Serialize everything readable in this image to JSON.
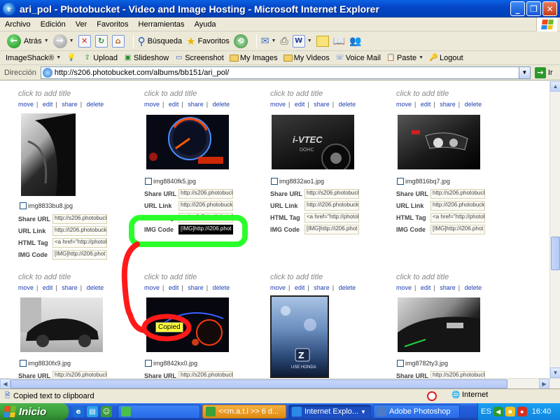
{
  "window": {
    "title": "ari_pol - Photobucket - Video and Image Hosting - Microsoft Internet Explorer",
    "controls": [
      "minimize",
      "maximize",
      "close"
    ]
  },
  "menu": [
    "Archivo",
    "Edición",
    "Ver",
    "Favoritos",
    "Herramientas",
    "Ayuda"
  ],
  "toolbar": {
    "back": "Atrás",
    "search": "Búsqueda",
    "favorites": "Favoritos"
  },
  "links_bar": {
    "imageshack": "ImageShack®",
    "upload": "Upload",
    "slideshow": "Slideshow",
    "screenshot": "Screenshot",
    "my_images": "My Images",
    "my_videos": "My Videos",
    "voice_mail": "Voice Mail",
    "paste": "Paste",
    "logout": "Logout"
  },
  "address": {
    "label": "Dirección",
    "url": "http://s206.photobucket.com/albums/bb151/ari_pol/",
    "go": "Ir"
  },
  "tile_common": {
    "title": "click to add title",
    "actions": [
      "move",
      "edit",
      "share",
      "delete"
    ],
    "labels": [
      "Share URL",
      "URL Link",
      "HTML Tag",
      "IMG Code"
    ],
    "values": [
      "http://s206.photobuck",
      "http://i206.photobuck",
      "<a href=\"http://photol",
      "[IMG]http://i206.phot"
    ]
  },
  "tiles_row1": [
    {
      "filename": "img8833bu8.jpg"
    },
    {
      "filename": "img8840fk5.jpg"
    },
    {
      "filename": "img8832ao1.jpg"
    },
    {
      "filename": "img8816bq7.jpg"
    }
  ],
  "tiles_row2": [
    {
      "filename": "img8830fx9.jpg"
    },
    {
      "filename": "img8842kx0.jpg"
    },
    {
      "filename": ""
    },
    {
      "filename": "img8782ty3.jpg"
    }
  ],
  "annotation": {
    "tooltip": "Copied",
    "highlight_color": "#2bff2b",
    "arrow_color": "#ff1a1a"
  },
  "photo_text": {
    "ivtec": "i-VTEC",
    "dohc": "DOHC",
    "use_honda": "USE HONDA"
  },
  "status": {
    "text": "Copied text to clipboard",
    "zone": "Internet"
  },
  "taskbar": {
    "start": "Inicio",
    "tasks": [
      "<<m.a.t.i >> 6 d...",
      "Internet Explo...",
      "Adobe Photoshop"
    ],
    "lang": "ES",
    "clock": "16:40"
  }
}
